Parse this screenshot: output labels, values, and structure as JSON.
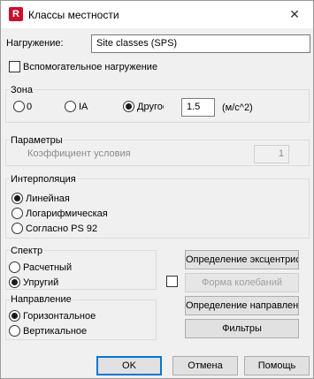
{
  "window": {
    "title": "Классы местности",
    "app_icon_letter": "R"
  },
  "load": {
    "label": "Нагружение:",
    "value": "Site classes (SPS)",
    "auxiliary_label": "Вспомогательное нагружение",
    "auxiliary_checked": false
  },
  "zone": {
    "label": "Зона",
    "options": [
      "0",
      "IA",
      "Другое"
    ],
    "selected": "Другое",
    "value": "1.5",
    "unit": "(м/с^2)"
  },
  "params": {
    "label": "Параметры",
    "coef_label": "Коэффициент условия",
    "coef_value": "1"
  },
  "interp": {
    "label": "Интерполяция",
    "options": [
      "Линейная",
      "Логарифмическая",
      "Согласно PS 92"
    ],
    "selected": "Линейная"
  },
  "spectrum": {
    "label": "Спектр",
    "options": [
      "Расчетный",
      "Упругий"
    ],
    "selected": "Упругий"
  },
  "direction": {
    "label": "Направление",
    "options": [
      "Горизонтальное",
      "Вертикальное"
    ],
    "selected": "Горизонтальное"
  },
  "side_buttons": {
    "eccentricity": "Определение эксцентриситета",
    "mode_shape": "Форма колебаний",
    "mode_shape_checked": false,
    "direction_def": "Определение направления",
    "filters": "Фильтры"
  },
  "footer": {
    "ok": "OK",
    "cancel": "Отмена",
    "help": "Помощь"
  }
}
